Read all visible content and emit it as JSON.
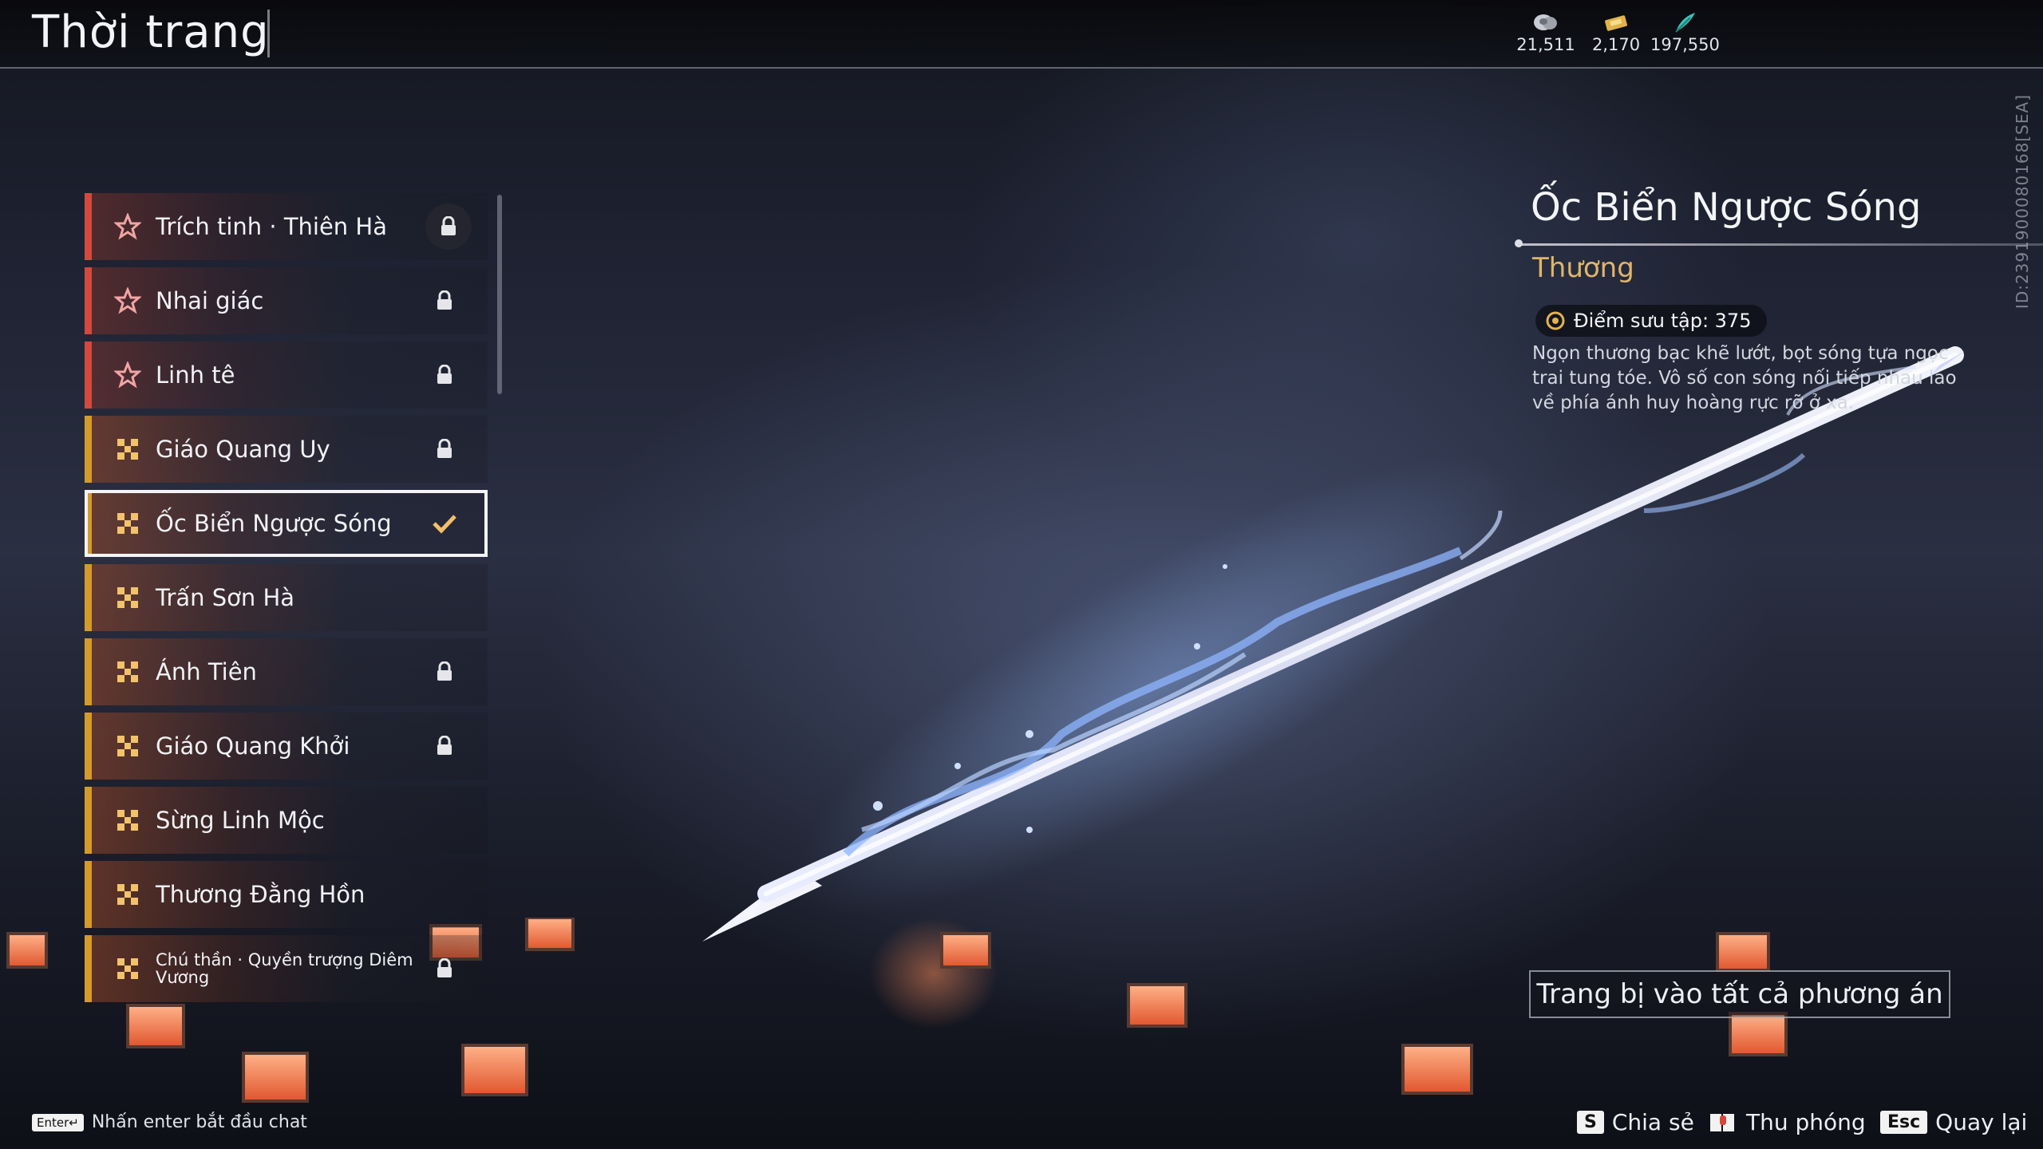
{
  "header": {
    "title": "Thời trang"
  },
  "currencies": [
    {
      "icon": "coin-icon",
      "value": "21,511"
    },
    {
      "icon": "ticket-icon",
      "value": "2,170"
    },
    {
      "icon": "feather-icon",
      "value": "197,550"
    }
  ],
  "list": {
    "items": [
      {
        "label": "Trích tinh · Thiên Hà",
        "rarity": "red",
        "status": "locked"
      },
      {
        "label": "Nhai giác",
        "rarity": "red",
        "status": "locked"
      },
      {
        "label": "Linh tê",
        "rarity": "red",
        "status": "locked"
      },
      {
        "label": "Giáo Quang Uy",
        "rarity": "gold",
        "status": "locked"
      },
      {
        "label": "Ốc Biển Ngược Sóng",
        "rarity": "gold",
        "status": "equipped"
      },
      {
        "label": "Trấn Sơn Hà",
        "rarity": "gold",
        "status": "owned"
      },
      {
        "label": "Ánh Tiên",
        "rarity": "gold",
        "status": "locked"
      },
      {
        "label": "Giáo Quang Khởi",
        "rarity": "gold",
        "status": "locked"
      },
      {
        "label": "Sừng Linh Mộc",
        "rarity": "gold",
        "status": "owned"
      },
      {
        "label": "Thương Đằng Hồn",
        "rarity": "gold",
        "status": "owned"
      },
      {
        "label": "Chú thần · Quyền trượng Diêm Vương",
        "rarity": "gold",
        "status": "locked"
      }
    ]
  },
  "detail": {
    "name": "Ốc Biển Ngược Sóng",
    "type": "Thương",
    "points": "Điểm sưu tập: 375",
    "description": "Ngọn thương bạc khẽ lướt, bọt sóng tựa ngọc trai tung tóe. Vô số con sóng nối tiếp nhau lao về phía ánh huy hoàng rực rỡ ở xa.",
    "id_text": "ID:2391900080168[SEA]"
  },
  "equip_button": {
    "label": "Trang bị vào tất cả phương án"
  },
  "chat": {
    "key": "Enter↵",
    "text": "Nhấn enter bắt đầu chat"
  },
  "hints": [
    {
      "key": "S",
      "label": "Chia sẻ"
    },
    {
      "key": "",
      "label": "Thu phóng"
    },
    {
      "key": "Esc",
      "label": "Quay lại"
    }
  ],
  "colors": {
    "red_rarity": "#d24a3d",
    "gold_rarity": "#d49b2c",
    "type_text": "#e0b56a"
  }
}
